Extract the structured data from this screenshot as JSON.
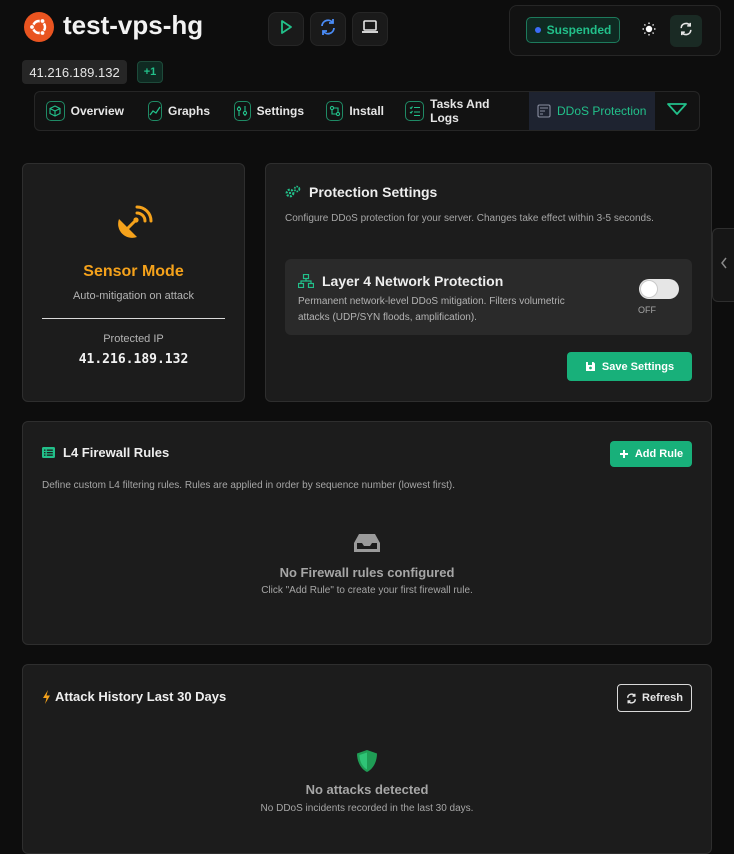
{
  "header": {
    "server_name": "test-vps-hg",
    "ip": "41.216.189.132",
    "extra_ips": "+1",
    "status": "Suspended",
    "actions": [
      "play-icon",
      "reinstall-icon",
      "console-icon"
    ],
    "theme_icon": "sun-icon",
    "refresh_icon": "refresh-icon"
  },
  "tabs": [
    {
      "label": "Overview",
      "icon": "cube-icon"
    },
    {
      "label": "Graphs",
      "icon": "chart-line-icon"
    },
    {
      "label": "Settings",
      "icon": "sliders-icon"
    },
    {
      "label": "Install",
      "icon": "install-icon"
    },
    {
      "label": "Tasks And Logs",
      "icon": "tasks-icon"
    },
    {
      "label": "DDoS Protection",
      "icon": "ddos-icon",
      "active": true
    }
  ],
  "sensor": {
    "mode": "Sensor Mode",
    "subtitle": "Auto-mitigation on attack",
    "protected_ip_label": "Protected IP",
    "protected_ip": "41.216.189.132"
  },
  "protection": {
    "title": "Protection Settings",
    "description": "Configure DDoS protection for your server. Changes take effect within 3-5 seconds.",
    "layer4_title": "Layer 4 Network Protection",
    "layer4_desc": "Permanent network-level DDoS mitigation. Filters volumetric attacks (UDP/SYN floods, amplification).",
    "toggle_state": "OFF",
    "save_label": "Save Settings"
  },
  "firewall": {
    "title": "L4 Firewall Rules",
    "add_label": "Add Rule",
    "description": "Define custom L4 filtering rules. Rules are applied in order by sequence number (lowest first).",
    "empty_title": "No Firewall rules configured",
    "empty_desc": "Click \"Add Rule\" to create your first firewall rule."
  },
  "history": {
    "title": "Attack History Last 30 Days",
    "refresh_label": "Refresh",
    "empty_title": "No attacks detected",
    "empty_desc": "No DDoS incidents recorded in the last 30 days."
  },
  "colors": {
    "accent": "#18b07a",
    "warning": "#f5a21b",
    "background": "#0d0d0d",
    "card": "#1c1c1c"
  }
}
